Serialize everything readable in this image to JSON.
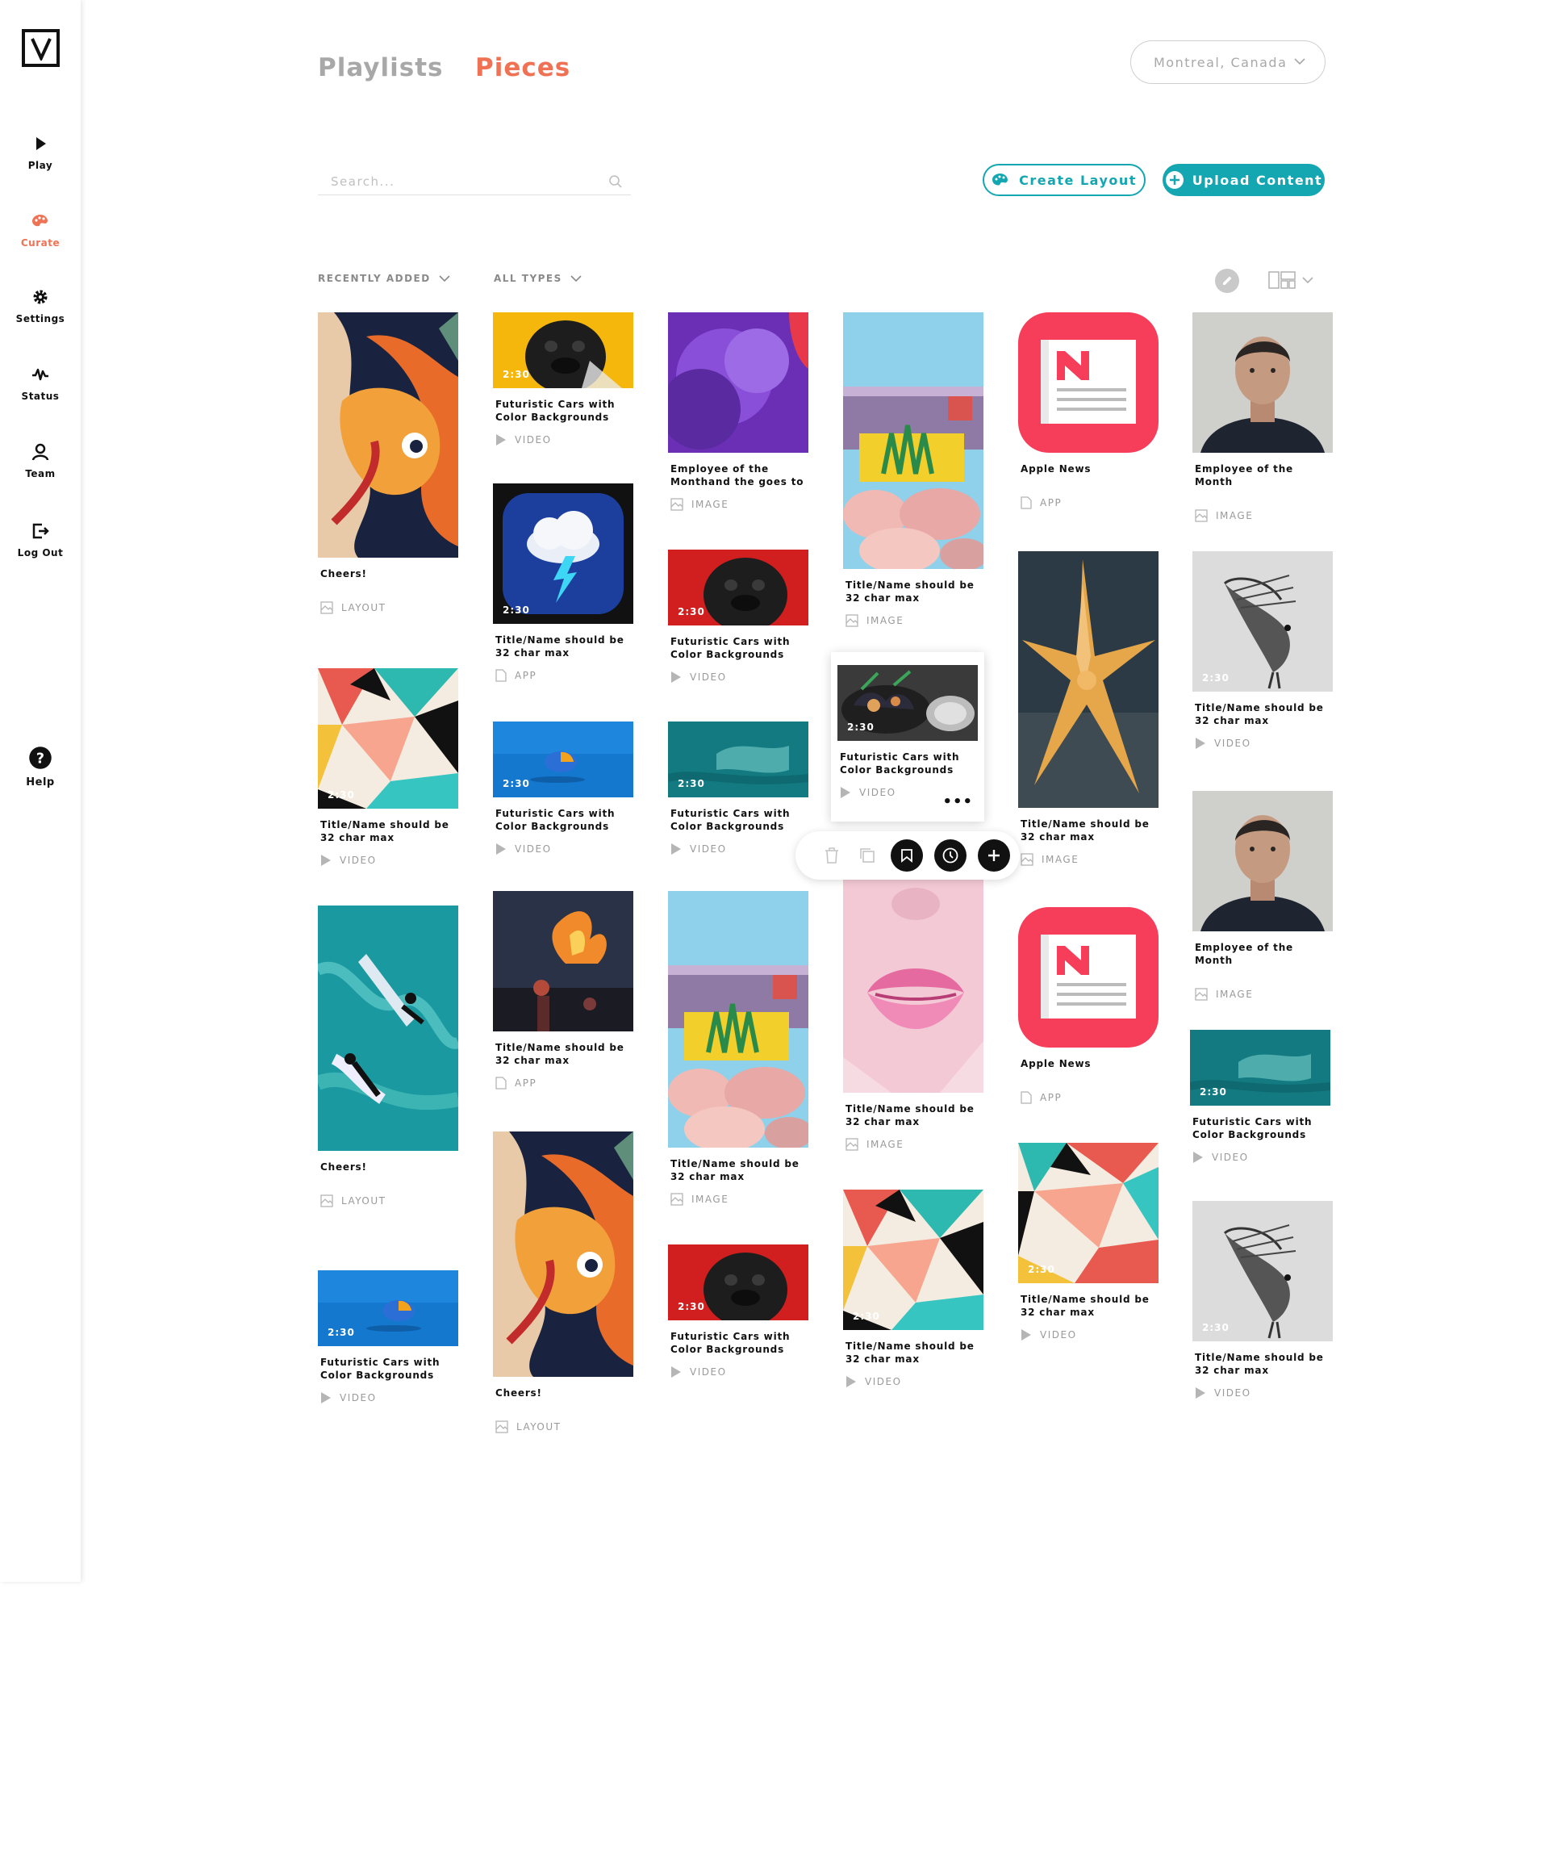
{
  "nav": {
    "logo": "V",
    "items": [
      {
        "label": "Play",
        "icon": "play-icon"
      },
      {
        "label": "Curate",
        "icon": "palette-icon"
      },
      {
        "label": "Settings",
        "icon": "gear-icon"
      },
      {
        "label": "Status",
        "icon": "pulse-icon"
      },
      {
        "label": "Team",
        "icon": "user-icon"
      },
      {
        "label": "Log Out",
        "icon": "logout-icon"
      }
    ],
    "help": {
      "label": "Help",
      "icon": "help-icon"
    }
  },
  "header": {
    "tabs": [
      {
        "label": "Playlists",
        "active": false
      },
      {
        "label": "Pieces",
        "active": true
      }
    ],
    "location": "Montreal, Canada"
  },
  "toolbar": {
    "search_placeholder": "Search...",
    "create_layout": "Create Layout",
    "upload_content": "Upload Content"
  },
  "filters": {
    "sort": "RECENTLY ADDED",
    "types": "ALL TYPES"
  },
  "colors": {
    "accent": "#f07255",
    "primary": "#14a7b2"
  },
  "cards": [
    {
      "title": "Cheers!",
      "type": "LAYOUT",
      "duration": ""
    },
    {
      "title": "Title/Name should be 32 char max",
      "type": "VIDEO",
      "duration": "2:30"
    },
    {
      "title": "Cheers!",
      "type": "LAYOUT",
      "duration": ""
    },
    {
      "title": "Futuristic Cars with Color Backgrounds",
      "type": "VIDEO",
      "duration": "2:30"
    },
    {
      "title": "Futuristic Cars with Color Backgrounds",
      "type": "VIDEO",
      "duration": "2:30"
    },
    {
      "title": "Title/Name should be 32 char max",
      "type": "APP",
      "duration": "2:30"
    },
    {
      "title": "Futuristic Cars with Color Backgrounds",
      "type": "VIDEO",
      "duration": "2:30"
    },
    {
      "title": "Title/Name should be 32 char max",
      "type": "APP",
      "duration": ""
    },
    {
      "title": "Cheers!",
      "type": "LAYOUT",
      "duration": ""
    },
    {
      "title": "Employee of the Monthand the goes to",
      "type": "IMAGE",
      "duration": ""
    },
    {
      "title": "Futuristic Cars with Color Backgrounds",
      "type": "VIDEO",
      "duration": "2:30"
    },
    {
      "title": "Futuristic Cars with Color Backgrounds",
      "type": "VIDEO",
      "duration": "2:30"
    },
    {
      "title": "Title/Name should be 32 char max",
      "type": "IMAGE",
      "duration": ""
    },
    {
      "title": "Futuristic Cars with Color Backgrounds",
      "type": "VIDEO",
      "duration": "2:30"
    },
    {
      "title": "Title/Name should be 32 char max",
      "type": "IMAGE",
      "duration": ""
    },
    {
      "title": "Futuristic Cars with Color Backgrounds",
      "type": "VIDEO",
      "duration": "2:30"
    },
    {
      "title": "Title/Name should be 32 char max",
      "type": "IMAGE",
      "duration": ""
    },
    {
      "title": "Title/Name should be 32 char max",
      "type": "VIDEO",
      "duration": "2:30"
    },
    {
      "title": "Apple News",
      "type": "APP",
      "duration": ""
    },
    {
      "title": "Title/Name should be 32 char max",
      "type": "IMAGE",
      "duration": ""
    },
    {
      "title": "Apple News",
      "type": "APP",
      "duration": ""
    },
    {
      "title": "Title/Name should be 32 char max",
      "type": "VIDEO",
      "duration": "2:30"
    },
    {
      "title": "Employee of the Month",
      "type": "IMAGE",
      "duration": ""
    },
    {
      "title": "Title/Name should be 32 char max",
      "type": "VIDEO",
      "duration": "2:30"
    },
    {
      "title": "Employee of the Month",
      "type": "IMAGE",
      "duration": ""
    },
    {
      "title": "Futuristic Cars with Color Backgrounds",
      "type": "VIDEO",
      "duration": "2:30"
    },
    {
      "title": "Title/Name should be 32 char max",
      "type": "VIDEO",
      "duration": "2:30"
    }
  ],
  "actions": [
    "trash-icon",
    "duplicate-icon",
    "bookmark-icon",
    "clock-icon",
    "plus-icon"
  ]
}
